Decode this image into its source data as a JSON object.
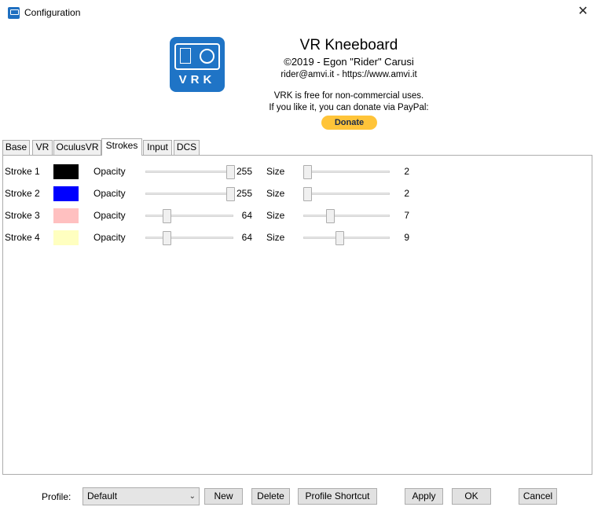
{
  "window": {
    "title": "Configuration",
    "close_glyph": "✕",
    "icon": "vrk-app-icon"
  },
  "header": {
    "logo_text": "VRK",
    "app_name": "VR Kneeboard",
    "copyright": "©2019 - Egon \"Rider\" Carusi",
    "contact": "rider@amvi.it - https://www.amvi.it",
    "free_notice": "VRK is free for non-commercial uses.",
    "donate_prompt": "If you like it, you can donate via PayPal:",
    "donate_label": "Donate"
  },
  "tabs": [
    {
      "label": "Base"
    },
    {
      "label": "VR"
    },
    {
      "label": "OculusVR"
    },
    {
      "label": "Strokes",
      "active": true
    },
    {
      "label": "Input"
    },
    {
      "label": "DCS"
    }
  ],
  "strokes": [
    {
      "label": "Stroke 1",
      "color": "#000000",
      "opacity_label": "Opacity",
      "opacity": "255",
      "size_label": "Size",
      "size": "2"
    },
    {
      "label": "Stroke 2",
      "color": "#0000ff",
      "opacity_label": "Opacity",
      "opacity": "255",
      "size_label": "Size",
      "size": "2"
    },
    {
      "label": "Stroke 3",
      "color": "#ffc0c0",
      "opacity_label": "Opacity",
      "opacity": "64",
      "size_label": "Size",
      "size": "7"
    },
    {
      "label": "Stroke 4",
      "color": "#ffffc0",
      "opacity_label": "Opacity",
      "opacity": "64",
      "size_label": "Size",
      "size": "9"
    }
  ],
  "footer": {
    "profile_label": "Profile:",
    "profile_value": "Default",
    "buttons": {
      "new": "New",
      "delete": "Delete",
      "profile_shortcut": "Profile Shortcut",
      "apply": "Apply",
      "ok": "OK",
      "cancel": "Cancel"
    }
  }
}
